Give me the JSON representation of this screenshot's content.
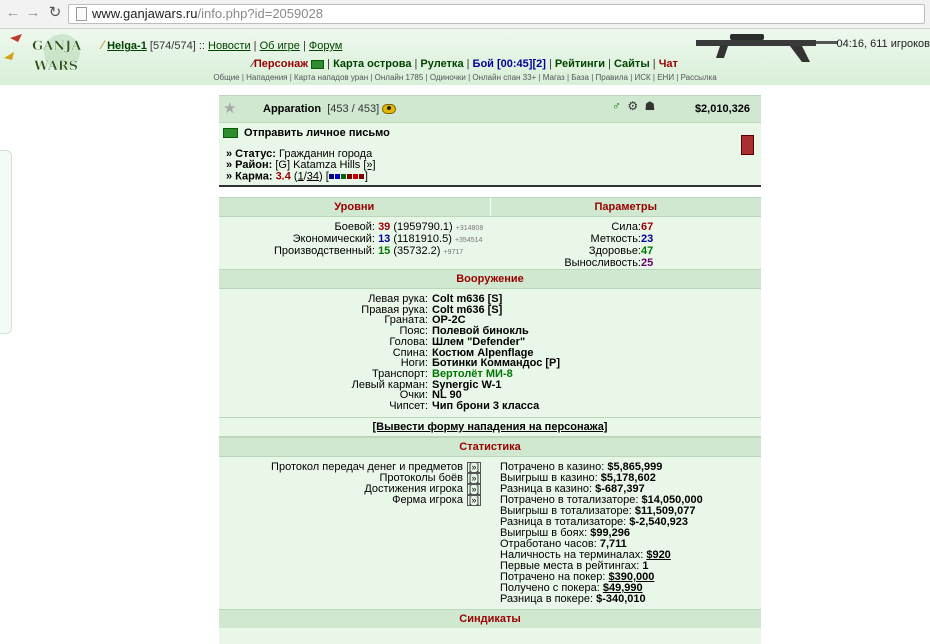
{
  "browser": {
    "url_domain": "www.ganjawars.ru",
    "url_path": "/info.php?id=2059028"
  },
  "header": {
    "logo_text_1": "GANJA",
    "logo_text_2": "WARS",
    "user": "Helga-1",
    "user_hp": "[574/574]",
    "sep": "::",
    "links": [
      "Новости",
      "Об игре",
      "Форум"
    ],
    "clock": "04:16, 611 игроков"
  },
  "menu": {
    "personazh": "Персонаж",
    "map": "Карта острова",
    "roulette": "Рулетка",
    "battle": "Бой [00:45][2]",
    "ratings": "Рейтинги",
    "sites": "Сайты",
    "chat": "Чат",
    "sep": "|"
  },
  "submenu": "Общие | Нападения | Карта нападов уран | Онлайн 1785 | Одиночки | Онлайн спан 33+ | Магаз | База | Правила | ИСК | ЕНИ | Рассылка",
  "profile": {
    "name": "Apparation",
    "hp": "[453 / 453]",
    "money": "$2,010,326",
    "send_message": "Отправить личное письмо",
    "status_label": "» Статус:",
    "status_value": "Гражданин города",
    "district_label": "» Район:",
    "district_value": "[G] Katamza Hills",
    "district_link": "[»]",
    "karma_label": "» Карма:",
    "karma_value": "3.4",
    "karma_detail_open": "(",
    "karma_a": "1",
    "karma_slash": "/",
    "karma_b": "34",
    "karma_detail_close": ")",
    "karma_colors": [
      "#000080",
      "#0000cc",
      "#006600",
      "#800000",
      "#cc0000",
      "#800000"
    ]
  },
  "levels": {
    "title": "Уровни",
    "rows": [
      {
        "label": "Боевой:",
        "level": "39",
        "points": "(1959790.1)",
        "delta": "+314808",
        "color": "#990000"
      },
      {
        "label": "Экономический:",
        "level": "13",
        "points": "(1181910.5)",
        "delta": "+354514",
        "color": "#000099"
      },
      {
        "label": "Производственный:",
        "level": "15",
        "points": "(35732.2)",
        "delta": "+9717",
        "color": "#007700"
      }
    ]
  },
  "params": {
    "title": "Параметры",
    "rows": [
      {
        "label": "Сила:",
        "value": "67",
        "color": "#990000"
      },
      {
        "label": "Меткость:",
        "value": "23",
        "color": "#000099"
      },
      {
        "label": "Здоровье:",
        "value": "47",
        "color": "#007700"
      },
      {
        "label": "Выносливость:",
        "value": "25",
        "color": "#660066"
      }
    ]
  },
  "weapons": {
    "title": "Вооружение",
    "rows": [
      {
        "label": "Левая рука:",
        "value": "Colt m636 [S]"
      },
      {
        "label": "Правая рука:",
        "value": "Colt m636 [S]"
      },
      {
        "label": "Граната:",
        "value": "OP-2C"
      },
      {
        "label": "Пояс:",
        "value": "Полевой бинокль"
      },
      {
        "label": "Голова:",
        "value": "Шлем \"Defender\""
      },
      {
        "label": "Спина:",
        "value": "Костюм Alpenflage"
      },
      {
        "label": "Ноги:",
        "value": "Ботинки Коммандос [P]"
      },
      {
        "label": "Транспорт:",
        "value": "Вертолёт МИ-8",
        "green": true
      },
      {
        "label": "Левый карман:",
        "value": "Synergic W-1"
      },
      {
        "label": "Очки:",
        "value": "NL 90"
      },
      {
        "label": "Чипсет:",
        "value": "Чип брони 3 класса"
      }
    ]
  },
  "attack_form": "[Вывести форму нападения на персонажа]",
  "stats": {
    "title": "Статистика",
    "protocols": [
      {
        "label": "Протокол передач денег и предметов",
        "arrow": "[»]"
      },
      {
        "label": "Протоколы боёв",
        "arrow": "[»]"
      },
      {
        "label": "Достижения игрока",
        "arrow": "[»]"
      },
      {
        "label": "Ферма игрока",
        "arrow": "[»]"
      }
    ],
    "rows": [
      {
        "label": "Потрачено в казино:",
        "value": "$5,865,999"
      },
      {
        "label": "Выигрыш в казино:",
        "value": "$5,178,602"
      },
      {
        "label": "Разница в казино:",
        "value": "$-687,397"
      },
      {
        "label": "Потрачено в тотализаторе:",
        "value": "$14,050,000"
      },
      {
        "label": "Выигрыш в тотализаторе:",
        "value": "$11,509,077"
      },
      {
        "label": "Разница в тотализаторе:",
        "value": "$-2,540,923"
      },
      {
        "label": "Выигрыш в боях:",
        "value": "$99,296"
      },
      {
        "label": "Отработано часов:",
        "value": "7,711"
      },
      {
        "label": "Наличность на терминалах:",
        "value": "$920",
        "link": true
      },
      {
        "label": "Первые места в рейтингах:",
        "value": "1"
      },
      {
        "label": "Потрачено на покер:",
        "value": "$390,000",
        "link": true
      },
      {
        "label": "Получено с покера:",
        "value": "$49,990",
        "link": true
      },
      {
        "label": "Разница в покере:",
        "value": "$-340,010"
      }
    ]
  },
  "syndicates_title": "Синдикаты"
}
